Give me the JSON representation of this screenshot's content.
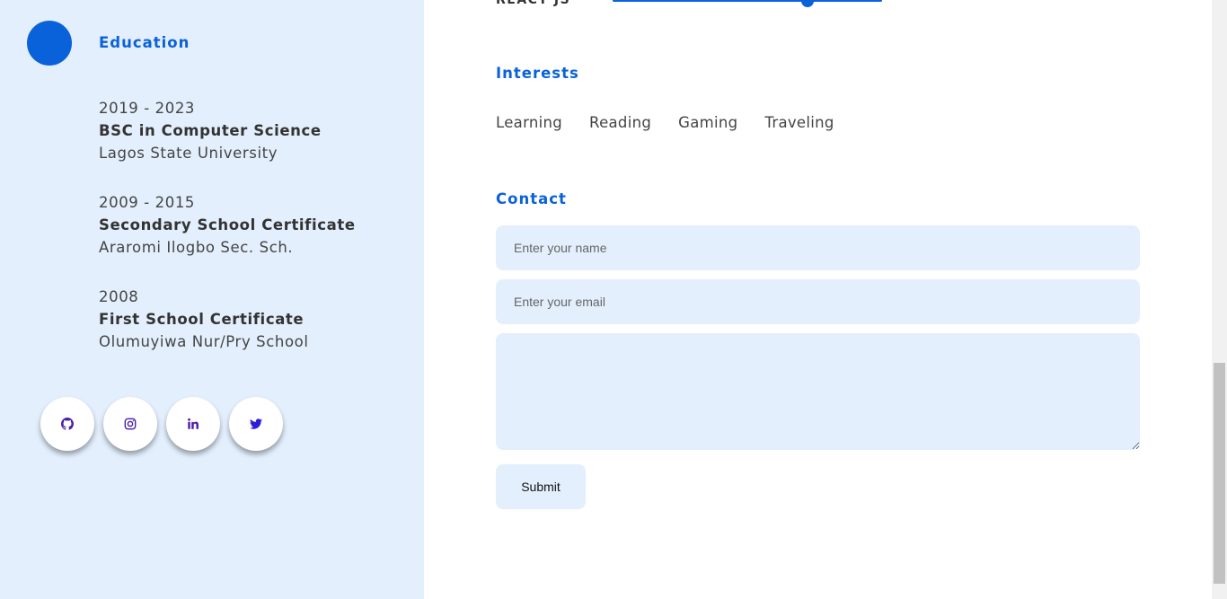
{
  "education": {
    "title": "Education",
    "items": [
      {
        "years": "2019 - 2023",
        "degree": "BSC in Computer Science",
        "school": "Lagos State University"
      },
      {
        "years": "2009 - 2015",
        "degree": "Secondary School Certificate",
        "school": "Araromi Ilogbo Sec. Sch."
      },
      {
        "years": "2008",
        "degree": "First School Certificate",
        "school": "Olumuyiwa Nur/Pry School"
      }
    ]
  },
  "socials": [
    {
      "icon": "github-icon"
    },
    {
      "icon": "instagram-icon"
    },
    {
      "icon": "linkedin-icon"
    },
    {
      "icon": "twitter-icon"
    }
  ],
  "skills": {
    "visible_label": "REACT JS"
  },
  "interests": {
    "title": "Interests",
    "items": [
      "Learning",
      "Reading",
      "Gaming",
      "Traveling"
    ]
  },
  "contact": {
    "title": "Contact",
    "name_placeholder": "Enter your name",
    "email_placeholder": "Enter your email",
    "submit_label": "Submit"
  },
  "colors": {
    "accent": "#0a62da",
    "sidebar_bg": "#e3effd",
    "social_icon": "#4b1fa8"
  }
}
